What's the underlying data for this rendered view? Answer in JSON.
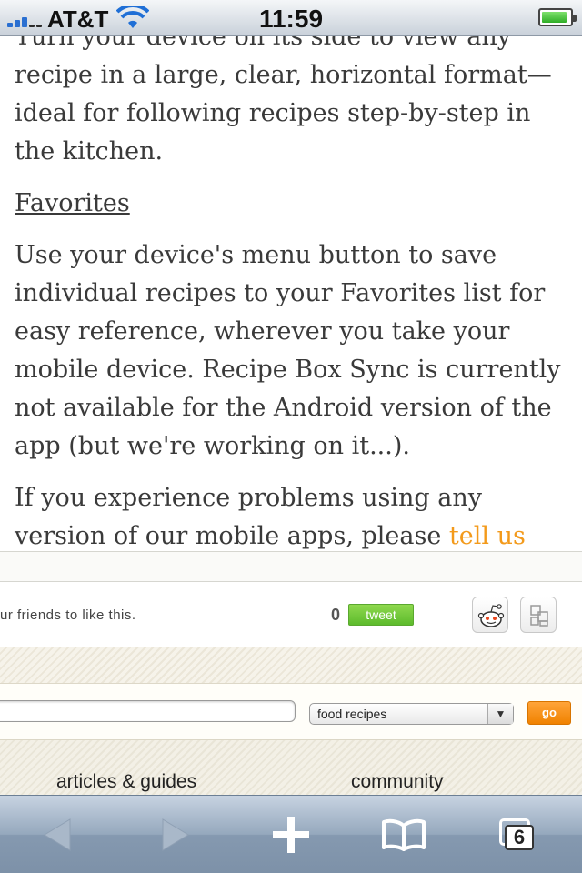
{
  "status_bar": {
    "carrier": "AT&T",
    "time": "11:59",
    "battery_level": 0.9
  },
  "article": {
    "paragraph1": "Turn your device on its side to view any recipe in a large, clear, horizontal format—ideal for following recipes step-by-step in the kitchen.",
    "heading": "Favorites",
    "paragraph2": "Use your device's menu button to save individual recipes to your Favorites list for easy reference, wherever you take your mobile device. Recipe Box Sync is currently not available for the Android version of the app (but we're working on it...).",
    "paragraph3_before": "If you experience problems using any version of our mobile apps, please ",
    "paragraph3_link": "tell us about it",
    "paragraph3_after": "."
  },
  "social": {
    "like_text": "ur friends to like this.",
    "tweet_count": "0",
    "tweet_label": "tweet",
    "icons": [
      "reddit-icon",
      "share-icon"
    ]
  },
  "search": {
    "query": "",
    "category": "food recipes",
    "go_label": "go"
  },
  "footer": {
    "links": [
      "articles & guides",
      "community"
    ]
  },
  "toolbar": {
    "tab_count": "6",
    "icons": [
      "back-arrow-icon",
      "forward-arrow-icon",
      "plus-icon",
      "bookmarks-icon",
      "tabs-icon"
    ]
  },
  "colors": {
    "link": "#f39a1b",
    "tweet_button": "#6cc43a",
    "go_button": "#f58a0f",
    "toolbar": "#8a9db3"
  }
}
